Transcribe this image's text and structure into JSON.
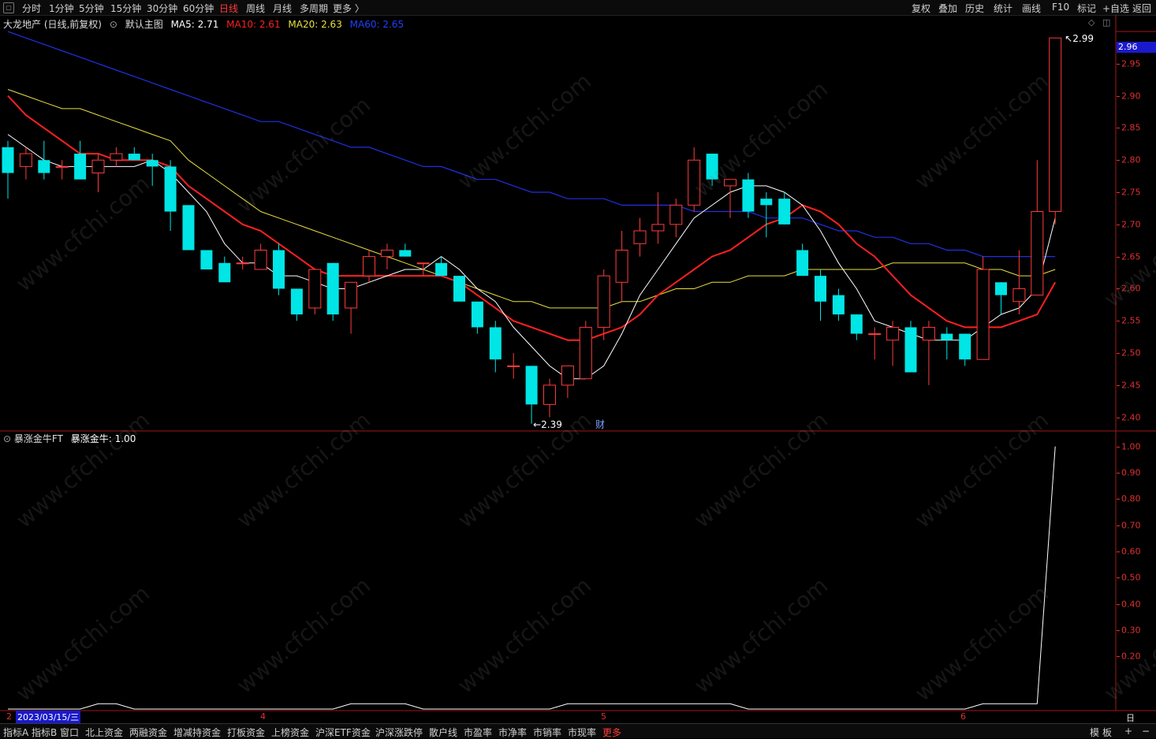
{
  "toolbar": {
    "periods": [
      "分时",
      "1分钟",
      "5分钟",
      "15分钟",
      "30分钟",
      "60分钟",
      "日线",
      "周线",
      "月线",
      "多周期",
      "更多 〉"
    ],
    "active_period": "日线",
    "right_items": [
      "复权",
      "叠加",
      "历史",
      "统计",
      "画线",
      "F10",
      "标记",
      "+自选",
      "返回"
    ]
  },
  "main_info": {
    "stock": "大龙地产 (日线,前复权)",
    "chart_name": "默认主图",
    "ma5_label": "MA5: 2.71",
    "ma10_label": "MA10: 2.61",
    "ma20_label": "MA20: 2.63",
    "ma60_label": "MA60: 2.65"
  },
  "sub_info": {
    "name": "暴涨金牛FT",
    "value_label": "暴涨金牛: 1.00"
  },
  "annotations": {
    "high_label": "2.99",
    "low_label": "2.39",
    "current_price": "2.96",
    "finance_marker": "财"
  },
  "date_axis": {
    "cursor_date": "2023/03/15/三",
    "months": [
      "4",
      "5",
      "6"
    ],
    "left_mark": "2"
  },
  "period_label": "日线",
  "bottom_tabs": [
    "指标A",
    "指标B",
    "窗口",
    "北上资金",
    "两融资金",
    "增减持资金",
    "打板资金",
    "上榜资金",
    "沪深ETF资金",
    "沪深涨跌停",
    "散户线",
    "市盈率",
    "市净率",
    "市销率",
    "市现率",
    "更多"
  ],
  "bottom_right": [
    "模",
    "板",
    "+",
    "−"
  ],
  "watermark": "www.cfchi.com",
  "colors": {
    "up": "#ff3b3b",
    "down": "#00e5e5",
    "ma5": "#ffffff",
    "ma10": "#ff2020",
    "ma20": "#e8e040",
    "ma60": "#2030e0",
    "axis": "#e03030"
  },
  "chart_data": [
    {
      "type": "candlestick",
      "title": "",
      "y_ticks": [
        2.4,
        2.45,
        2.5,
        2.55,
        2.6,
        2.65,
        2.7,
        2.75,
        2.8,
        2.85,
        2.9,
        2.95
      ],
      "ylim": [
        2.38,
        3.0
      ],
      "candles": [
        {
          "o": 2.82,
          "h": 2.83,
          "l": 2.74,
          "c": 2.78
        },
        {
          "o": 2.79,
          "h": 2.82,
          "l": 2.77,
          "c": 2.81
        },
        {
          "o": 2.8,
          "h": 2.83,
          "l": 2.77,
          "c": 2.78
        },
        {
          "o": 2.79,
          "h": 2.8,
          "l": 2.77,
          "c": 2.79
        },
        {
          "o": 2.81,
          "h": 2.83,
          "l": 2.77,
          "c": 2.77
        },
        {
          "o": 2.78,
          "h": 2.81,
          "l": 2.75,
          "c": 2.8
        },
        {
          "o": 2.8,
          "h": 2.82,
          "l": 2.79,
          "c": 2.81
        },
        {
          "o": 2.81,
          "h": 2.82,
          "l": 2.8,
          "c": 2.8
        },
        {
          "o": 2.8,
          "h": 2.81,
          "l": 2.76,
          "c": 2.79
        },
        {
          "o": 2.79,
          "h": 2.8,
          "l": 2.69,
          "c": 2.72
        },
        {
          "o": 2.73,
          "h": 2.73,
          "l": 2.66,
          "c": 2.66
        },
        {
          "o": 2.66,
          "h": 2.66,
          "l": 2.63,
          "c": 2.63
        },
        {
          "o": 2.64,
          "h": 2.65,
          "l": 2.61,
          "c": 2.61
        },
        {
          "o": 2.64,
          "h": 2.65,
          "l": 2.63,
          "c": 2.64
        },
        {
          "o": 2.63,
          "h": 2.67,
          "l": 2.63,
          "c": 2.66
        },
        {
          "o": 2.66,
          "h": 2.67,
          "l": 2.59,
          "c": 2.6
        },
        {
          "o": 2.6,
          "h": 2.6,
          "l": 2.55,
          "c": 2.56
        },
        {
          "o": 2.57,
          "h": 2.63,
          "l": 2.56,
          "c": 2.63
        },
        {
          "o": 2.64,
          "h": 2.64,
          "l": 2.55,
          "c": 2.56
        },
        {
          "o": 2.57,
          "h": 2.61,
          "l": 2.53,
          "c": 2.61
        },
        {
          "o": 2.62,
          "h": 2.66,
          "l": 2.61,
          "c": 2.65
        },
        {
          "o": 2.65,
          "h": 2.67,
          "l": 2.63,
          "c": 2.66
        },
        {
          "o": 2.66,
          "h": 2.67,
          "l": 2.65,
          "c": 2.65
        },
        {
          "o": 2.64,
          "h": 2.64,
          "l": 2.62,
          "c": 2.64
        },
        {
          "o": 2.64,
          "h": 2.65,
          "l": 2.62,
          "c": 2.62
        },
        {
          "o": 2.62,
          "h": 2.62,
          "l": 2.58,
          "c": 2.58
        },
        {
          "o": 2.58,
          "h": 2.58,
          "l": 2.53,
          "c": 2.54
        },
        {
          "o": 2.54,
          "h": 2.55,
          "l": 2.47,
          "c": 2.49
        },
        {
          "o": 2.48,
          "h": 2.5,
          "l": 2.46,
          "c": 2.48
        },
        {
          "o": 2.48,
          "h": 2.48,
          "l": 2.39,
          "c": 2.42
        },
        {
          "o": 2.42,
          "h": 2.46,
          "l": 2.4,
          "c": 2.45
        },
        {
          "o": 2.45,
          "h": 2.48,
          "l": 2.43,
          "c": 2.48
        },
        {
          "o": 2.46,
          "h": 2.55,
          "l": 2.46,
          "c": 2.54
        },
        {
          "o": 2.54,
          "h": 2.63,
          "l": 2.52,
          "c": 2.62
        },
        {
          "o": 2.61,
          "h": 2.69,
          "l": 2.58,
          "c": 2.66
        },
        {
          "o": 2.67,
          "h": 2.71,
          "l": 2.65,
          "c": 2.69
        },
        {
          "o": 2.69,
          "h": 2.75,
          "l": 2.67,
          "c": 2.7
        },
        {
          "o": 2.7,
          "h": 2.74,
          "l": 2.68,
          "c": 2.73
        },
        {
          "o": 2.73,
          "h": 2.82,
          "l": 2.72,
          "c": 2.8
        },
        {
          "o": 2.81,
          "h": 2.81,
          "l": 2.76,
          "c": 2.77
        },
        {
          "o": 2.76,
          "h": 2.77,
          "l": 2.71,
          "c": 2.77
        },
        {
          "o": 2.77,
          "h": 2.78,
          "l": 2.71,
          "c": 2.72
        },
        {
          "o": 2.74,
          "h": 2.75,
          "l": 2.68,
          "c": 2.73
        },
        {
          "o": 2.74,
          "h": 2.75,
          "l": 2.7,
          "c": 2.7
        },
        {
          "o": 2.66,
          "h": 2.67,
          "l": 2.63,
          "c": 2.62
        },
        {
          "o": 2.62,
          "h": 2.63,
          "l": 2.55,
          "c": 2.58
        },
        {
          "o": 2.59,
          "h": 2.6,
          "l": 2.55,
          "c": 2.56
        },
        {
          "o": 2.56,
          "h": 2.56,
          "l": 2.52,
          "c": 2.53
        },
        {
          "o": 2.53,
          "h": 2.54,
          "l": 2.49,
          "c": 2.53
        },
        {
          "o": 2.52,
          "h": 2.55,
          "l": 2.48,
          "c": 2.54
        },
        {
          "o": 2.54,
          "h": 2.55,
          "l": 2.47,
          "c": 2.47
        },
        {
          "o": 2.52,
          "h": 2.55,
          "l": 2.45,
          "c": 2.54
        },
        {
          "o": 2.53,
          "h": 2.54,
          "l": 2.49,
          "c": 2.52
        },
        {
          "o": 2.53,
          "h": 2.53,
          "l": 2.48,
          "c": 2.49
        },
        {
          "o": 2.49,
          "h": 2.65,
          "l": 2.49,
          "c": 2.63
        },
        {
          "o": 2.61,
          "h": 2.61,
          "l": 2.56,
          "c": 2.59
        },
        {
          "o": 2.58,
          "h": 2.66,
          "l": 2.56,
          "c": 2.6
        },
        {
          "o": 2.59,
          "h": 2.8,
          "l": 2.59,
          "c": 2.72
        },
        {
          "o": 2.72,
          "h": 2.99,
          "l": 2.7,
          "c": 2.99
        }
      ],
      "ma5": [
        2.84,
        2.82,
        2.8,
        2.79,
        2.79,
        2.79,
        2.79,
        2.79,
        2.8,
        2.78,
        2.75,
        2.72,
        2.67,
        2.64,
        2.64,
        2.62,
        2.62,
        2.61,
        2.6,
        2.6,
        2.61,
        2.62,
        2.63,
        2.63,
        2.65,
        2.63,
        2.6,
        2.58,
        2.54,
        2.51,
        2.48,
        2.46,
        2.46,
        2.48,
        2.53,
        2.59,
        2.63,
        2.67,
        2.71,
        2.73,
        2.75,
        2.76,
        2.76,
        2.75,
        2.73,
        2.69,
        2.64,
        2.6,
        2.55,
        2.54,
        2.53,
        2.52,
        2.52,
        2.52,
        2.54,
        2.56,
        2.57,
        2.6,
        2.71
      ],
      "ma10": [
        2.9,
        2.87,
        2.85,
        2.83,
        2.81,
        2.81,
        2.8,
        2.8,
        2.8,
        2.79,
        2.76,
        2.74,
        2.72,
        2.7,
        2.69,
        2.67,
        2.65,
        2.63,
        2.62,
        2.62,
        2.62,
        2.62,
        2.62,
        2.62,
        2.62,
        2.61,
        2.59,
        2.57,
        2.55,
        2.54,
        2.53,
        2.52,
        2.52,
        2.53,
        2.54,
        2.56,
        2.59,
        2.61,
        2.63,
        2.65,
        2.66,
        2.68,
        2.7,
        2.71,
        2.73,
        2.72,
        2.7,
        2.67,
        2.65,
        2.62,
        2.59,
        2.57,
        2.55,
        2.54,
        2.54,
        2.54,
        2.55,
        2.56,
        2.61
      ],
      "ma20": [
        2.91,
        2.9,
        2.89,
        2.88,
        2.88,
        2.87,
        2.86,
        2.85,
        2.84,
        2.83,
        2.8,
        2.78,
        2.76,
        2.74,
        2.72,
        2.71,
        2.7,
        2.69,
        2.68,
        2.67,
        2.66,
        2.65,
        2.64,
        2.63,
        2.62,
        2.61,
        2.6,
        2.59,
        2.58,
        2.58,
        2.57,
        2.57,
        2.57,
        2.57,
        2.58,
        2.58,
        2.59,
        2.6,
        2.6,
        2.61,
        2.61,
        2.62,
        2.62,
        2.62,
        2.63,
        2.63,
        2.63,
        2.63,
        2.63,
        2.64,
        2.64,
        2.64,
        2.64,
        2.64,
        2.63,
        2.63,
        2.62,
        2.62,
        2.63
      ],
      "ma60": [
        3.0,
        2.99,
        2.98,
        2.97,
        2.96,
        2.95,
        2.94,
        2.93,
        2.92,
        2.91,
        2.9,
        2.89,
        2.88,
        2.87,
        2.86,
        2.86,
        2.85,
        2.84,
        2.83,
        2.82,
        2.82,
        2.81,
        2.8,
        2.79,
        2.79,
        2.78,
        2.77,
        2.77,
        2.76,
        2.75,
        2.75,
        2.74,
        2.74,
        2.74,
        2.73,
        2.73,
        2.73,
        2.73,
        2.72,
        2.72,
        2.72,
        2.72,
        2.71,
        2.71,
        2.71,
        2.7,
        2.69,
        2.69,
        2.68,
        2.68,
        2.67,
        2.67,
        2.66,
        2.66,
        2.65,
        2.65,
        2.65,
        2.65,
        2.65
      ]
    },
    {
      "type": "line",
      "title": "暴涨金牛FT",
      "series": [
        {
          "name": "暴涨金牛",
          "values": [
            0,
            0,
            0,
            0,
            0,
            0.02,
            0.02,
            0,
            0,
            0,
            0,
            0,
            0,
            0,
            0,
            0,
            0,
            0,
            0,
            0.02,
            0.02,
            0.02,
            0.02,
            0,
            0,
            0,
            0,
            0,
            0,
            0,
            0,
            0.02,
            0.02,
            0.02,
            0.02,
            0.02,
            0.02,
            0.02,
            0.02,
            0.02,
            0.02,
            0,
            0,
            0,
            0,
            0,
            0,
            0,
            0,
            0,
            0,
            0,
            0,
            0,
            0.02,
            0.02,
            0.02,
            0.02,
            1.0
          ]
        }
      ],
      "y_ticks": [
        0.2,
        0.3,
        0.4,
        0.5,
        0.6,
        0.7,
        0.8,
        0.9,
        1.0
      ],
      "ylim": [
        0,
        1.05
      ]
    }
  ]
}
